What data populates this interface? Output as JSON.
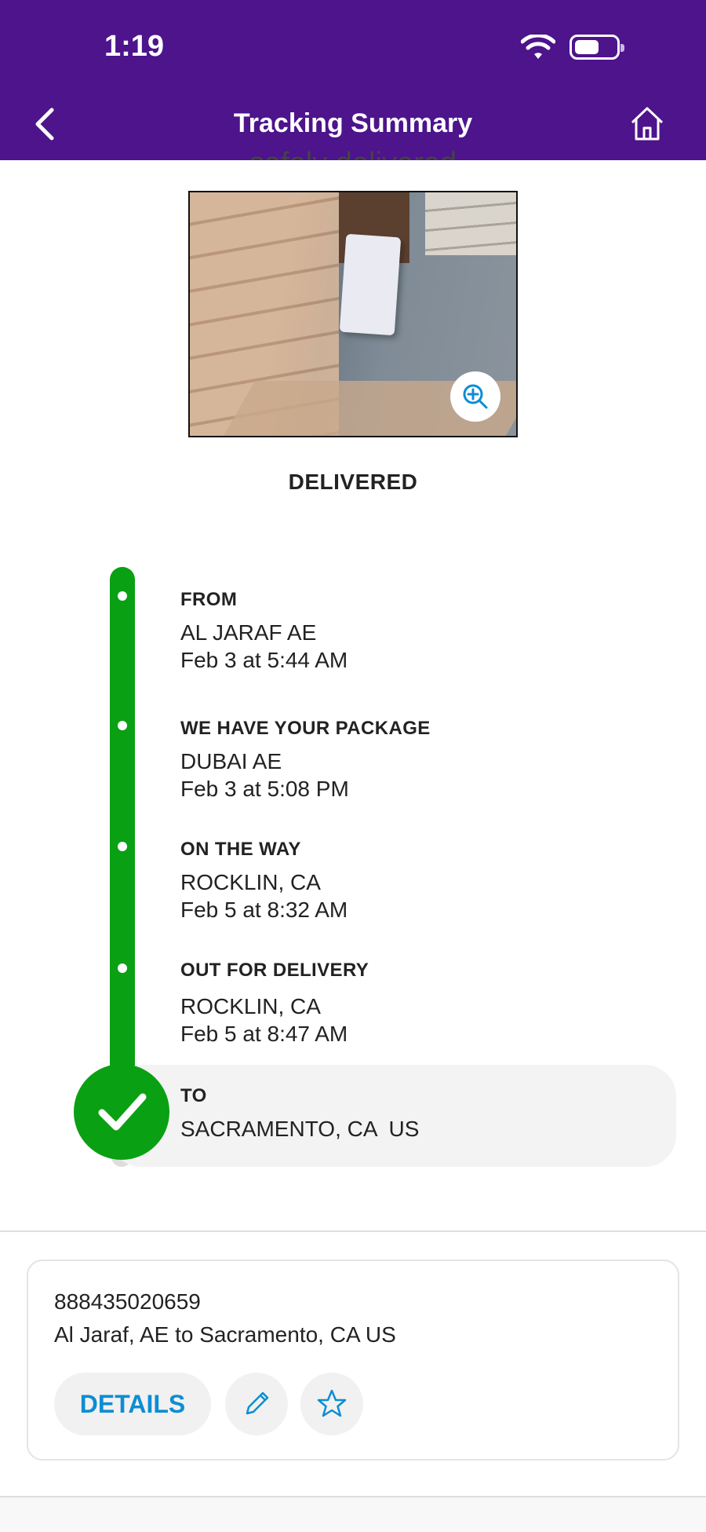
{
  "status_bar": {
    "time": "1:19",
    "wifi_icon": "wifi-icon",
    "battery_icon": "battery-icon"
  },
  "header": {
    "title": "Tracking Summary",
    "back_icon": "chevron-left-icon",
    "home_icon": "home-icon"
  },
  "delivery": {
    "clipped_message": "safely delivered",
    "status": "DELIVERED",
    "zoom_icon": "zoom-in-icon"
  },
  "timeline": [
    {
      "title": "FROM",
      "location": "AL JARAF AE",
      "time": "Feb 3 at 5:44 AM"
    },
    {
      "title": "WE HAVE YOUR PACKAGE",
      "location": "DUBAI AE",
      "time": "Feb 3 at 5:08 PM"
    },
    {
      "title": "ON THE WAY",
      "location": "ROCKLIN, CA",
      "time": "Feb 5 at 8:32 AM"
    },
    {
      "title": "OUT FOR DELIVERY",
      "location": "ROCKLIN, CA",
      "time": "Feb 5 at 8:47 AM"
    },
    {
      "title": "TO",
      "location": "SACRAMENTO, CA  US",
      "time": ""
    }
  ],
  "shipment": {
    "tracking_number": "888435020659",
    "route": "Al Jaraf, AE to Sacramento, CA US",
    "details_label": "DETAILS",
    "edit_icon": "pencil-icon",
    "favorite_icon": "star-icon"
  },
  "colors": {
    "header": "#4d148c",
    "progress": "#0aa013",
    "link": "#0d8dd3"
  }
}
